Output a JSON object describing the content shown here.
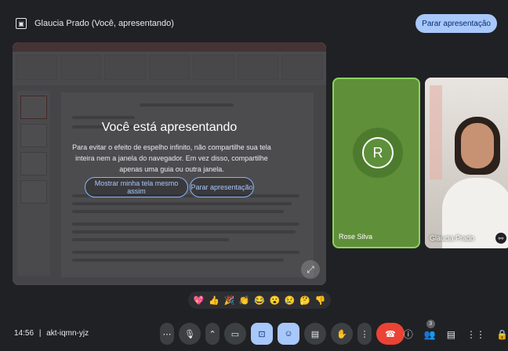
{
  "topbar": {
    "presenter_label": "Glaucia Prado (Você, apresentando)",
    "stop_label": "Parar apresentação"
  },
  "presentation_overlay": {
    "title": "Você está apresentando",
    "message": "Para evitar o efeito de espelho infinito, não compartilhe sua tela inteira nem a janela do navegador. Em vez disso, compartilhe apenas uma guia ou outra janela.",
    "show_anyway_label": "Mostrar minha tela mesmo assim",
    "stop_label": "Parar apresentação"
  },
  "participants": [
    {
      "name": "Rose Silva",
      "initial": "R",
      "avatar_color": "#5e8f3a"
    },
    {
      "name": "Glaucia Prado"
    }
  ],
  "reactions": [
    "💖",
    "👍",
    "🎉",
    "👏",
    "😂",
    "😮",
    "😢",
    "🤔",
    "👎"
  ],
  "bottombar": {
    "time": "14:56",
    "separator": "|",
    "meeting_code": "akt-iqmn-yjz",
    "participant_count": "3"
  },
  "colors": {
    "background": "#202124",
    "accent": "#a8c7fa",
    "end_call": "#ea4335",
    "speaking_border": "#8ed25f"
  }
}
